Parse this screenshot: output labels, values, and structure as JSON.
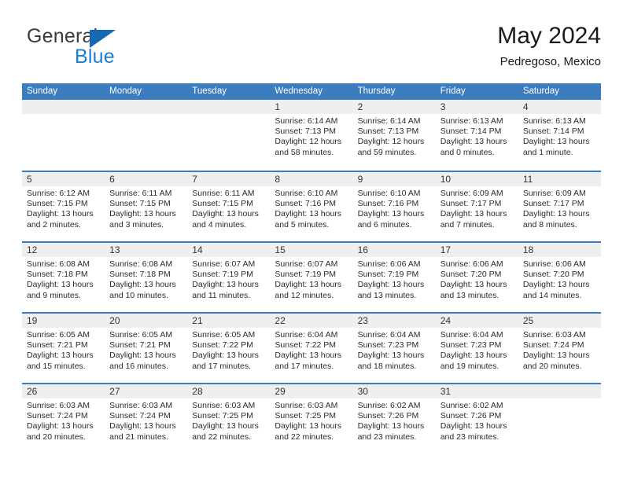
{
  "brand": {
    "name_top": "General",
    "name_bottom": "Blue",
    "accent_color": "#1668b3",
    "blue_text_color": "#1b7fd4"
  },
  "header": {
    "title": "May 2024",
    "subtitle": "Pedregoso, Mexico"
  },
  "theme": {
    "header_blue": "#3b7dbf",
    "daynum_band": "#efefef",
    "text": "#2b2b2b"
  },
  "weekdays": [
    "Sunday",
    "Monday",
    "Tuesday",
    "Wednesday",
    "Thursday",
    "Friday",
    "Saturday"
  ],
  "weeks": [
    [
      {
        "day": "",
        "sunrise": "",
        "sunset": "",
        "daylight_line1": "",
        "daylight_line2": "",
        "empty": true
      },
      {
        "day": "",
        "sunrise": "",
        "sunset": "",
        "daylight_line1": "",
        "daylight_line2": "",
        "empty": true
      },
      {
        "day": "",
        "sunrise": "",
        "sunset": "",
        "daylight_line1": "",
        "daylight_line2": "",
        "empty": true
      },
      {
        "day": "1",
        "sunrise": "Sunrise: 6:14 AM",
        "sunset": "Sunset: 7:13 PM",
        "daylight_line1": "Daylight: 12 hours",
        "daylight_line2": "and 58 minutes."
      },
      {
        "day": "2",
        "sunrise": "Sunrise: 6:14 AM",
        "sunset": "Sunset: 7:13 PM",
        "daylight_line1": "Daylight: 12 hours",
        "daylight_line2": "and 59 minutes."
      },
      {
        "day": "3",
        "sunrise": "Sunrise: 6:13 AM",
        "sunset": "Sunset: 7:14 PM",
        "daylight_line1": "Daylight: 13 hours",
        "daylight_line2": "and 0 minutes."
      },
      {
        "day": "4",
        "sunrise": "Sunrise: 6:13 AM",
        "sunset": "Sunset: 7:14 PM",
        "daylight_line1": "Daylight: 13 hours",
        "daylight_line2": "and 1 minute."
      }
    ],
    [
      {
        "day": "5",
        "sunrise": "Sunrise: 6:12 AM",
        "sunset": "Sunset: 7:15 PM",
        "daylight_line1": "Daylight: 13 hours",
        "daylight_line2": "and 2 minutes."
      },
      {
        "day": "6",
        "sunrise": "Sunrise: 6:11 AM",
        "sunset": "Sunset: 7:15 PM",
        "daylight_line1": "Daylight: 13 hours",
        "daylight_line2": "and 3 minutes."
      },
      {
        "day": "7",
        "sunrise": "Sunrise: 6:11 AM",
        "sunset": "Sunset: 7:15 PM",
        "daylight_line1": "Daylight: 13 hours",
        "daylight_line2": "and 4 minutes."
      },
      {
        "day": "8",
        "sunrise": "Sunrise: 6:10 AM",
        "sunset": "Sunset: 7:16 PM",
        "daylight_line1": "Daylight: 13 hours",
        "daylight_line2": "and 5 minutes."
      },
      {
        "day": "9",
        "sunrise": "Sunrise: 6:10 AM",
        "sunset": "Sunset: 7:16 PM",
        "daylight_line1": "Daylight: 13 hours",
        "daylight_line2": "and 6 minutes."
      },
      {
        "day": "10",
        "sunrise": "Sunrise: 6:09 AM",
        "sunset": "Sunset: 7:17 PM",
        "daylight_line1": "Daylight: 13 hours",
        "daylight_line2": "and 7 minutes."
      },
      {
        "day": "11",
        "sunrise": "Sunrise: 6:09 AM",
        "sunset": "Sunset: 7:17 PM",
        "daylight_line1": "Daylight: 13 hours",
        "daylight_line2": "and 8 minutes."
      }
    ],
    [
      {
        "day": "12",
        "sunrise": "Sunrise: 6:08 AM",
        "sunset": "Sunset: 7:18 PM",
        "daylight_line1": "Daylight: 13 hours",
        "daylight_line2": "and 9 minutes."
      },
      {
        "day": "13",
        "sunrise": "Sunrise: 6:08 AM",
        "sunset": "Sunset: 7:18 PM",
        "daylight_line1": "Daylight: 13 hours",
        "daylight_line2": "and 10 minutes."
      },
      {
        "day": "14",
        "sunrise": "Sunrise: 6:07 AM",
        "sunset": "Sunset: 7:19 PM",
        "daylight_line1": "Daylight: 13 hours",
        "daylight_line2": "and 11 minutes."
      },
      {
        "day": "15",
        "sunrise": "Sunrise: 6:07 AM",
        "sunset": "Sunset: 7:19 PM",
        "daylight_line1": "Daylight: 13 hours",
        "daylight_line2": "and 12 minutes."
      },
      {
        "day": "16",
        "sunrise": "Sunrise: 6:06 AM",
        "sunset": "Sunset: 7:19 PM",
        "daylight_line1": "Daylight: 13 hours",
        "daylight_line2": "and 13 minutes."
      },
      {
        "day": "17",
        "sunrise": "Sunrise: 6:06 AM",
        "sunset": "Sunset: 7:20 PM",
        "daylight_line1": "Daylight: 13 hours",
        "daylight_line2": "and 13 minutes."
      },
      {
        "day": "18",
        "sunrise": "Sunrise: 6:06 AM",
        "sunset": "Sunset: 7:20 PM",
        "daylight_line1": "Daylight: 13 hours",
        "daylight_line2": "and 14 minutes."
      }
    ],
    [
      {
        "day": "19",
        "sunrise": "Sunrise: 6:05 AM",
        "sunset": "Sunset: 7:21 PM",
        "daylight_line1": "Daylight: 13 hours",
        "daylight_line2": "and 15 minutes."
      },
      {
        "day": "20",
        "sunrise": "Sunrise: 6:05 AM",
        "sunset": "Sunset: 7:21 PM",
        "daylight_line1": "Daylight: 13 hours",
        "daylight_line2": "and 16 minutes."
      },
      {
        "day": "21",
        "sunrise": "Sunrise: 6:05 AM",
        "sunset": "Sunset: 7:22 PM",
        "daylight_line1": "Daylight: 13 hours",
        "daylight_line2": "and 17 minutes."
      },
      {
        "day": "22",
        "sunrise": "Sunrise: 6:04 AM",
        "sunset": "Sunset: 7:22 PM",
        "daylight_line1": "Daylight: 13 hours",
        "daylight_line2": "and 17 minutes."
      },
      {
        "day": "23",
        "sunrise": "Sunrise: 6:04 AM",
        "sunset": "Sunset: 7:23 PM",
        "daylight_line1": "Daylight: 13 hours",
        "daylight_line2": "and 18 minutes."
      },
      {
        "day": "24",
        "sunrise": "Sunrise: 6:04 AM",
        "sunset": "Sunset: 7:23 PM",
        "daylight_line1": "Daylight: 13 hours",
        "daylight_line2": "and 19 minutes."
      },
      {
        "day": "25",
        "sunrise": "Sunrise: 6:03 AM",
        "sunset": "Sunset: 7:24 PM",
        "daylight_line1": "Daylight: 13 hours",
        "daylight_line2": "and 20 minutes."
      }
    ],
    [
      {
        "day": "26",
        "sunrise": "Sunrise: 6:03 AM",
        "sunset": "Sunset: 7:24 PM",
        "daylight_line1": "Daylight: 13 hours",
        "daylight_line2": "and 20 minutes."
      },
      {
        "day": "27",
        "sunrise": "Sunrise: 6:03 AM",
        "sunset": "Sunset: 7:24 PM",
        "daylight_line1": "Daylight: 13 hours",
        "daylight_line2": "and 21 minutes."
      },
      {
        "day": "28",
        "sunrise": "Sunrise: 6:03 AM",
        "sunset": "Sunset: 7:25 PM",
        "daylight_line1": "Daylight: 13 hours",
        "daylight_line2": "and 22 minutes."
      },
      {
        "day": "29",
        "sunrise": "Sunrise: 6:03 AM",
        "sunset": "Sunset: 7:25 PM",
        "daylight_line1": "Daylight: 13 hours",
        "daylight_line2": "and 22 minutes."
      },
      {
        "day": "30",
        "sunrise": "Sunrise: 6:02 AM",
        "sunset": "Sunset: 7:26 PM",
        "daylight_line1": "Daylight: 13 hours",
        "daylight_line2": "and 23 minutes."
      },
      {
        "day": "31",
        "sunrise": "Sunrise: 6:02 AM",
        "sunset": "Sunset: 7:26 PM",
        "daylight_line1": "Daylight: 13 hours",
        "daylight_line2": "and 23 minutes."
      },
      {
        "day": "",
        "sunrise": "",
        "sunset": "",
        "daylight_line1": "",
        "daylight_line2": "",
        "empty": true
      }
    ]
  ]
}
